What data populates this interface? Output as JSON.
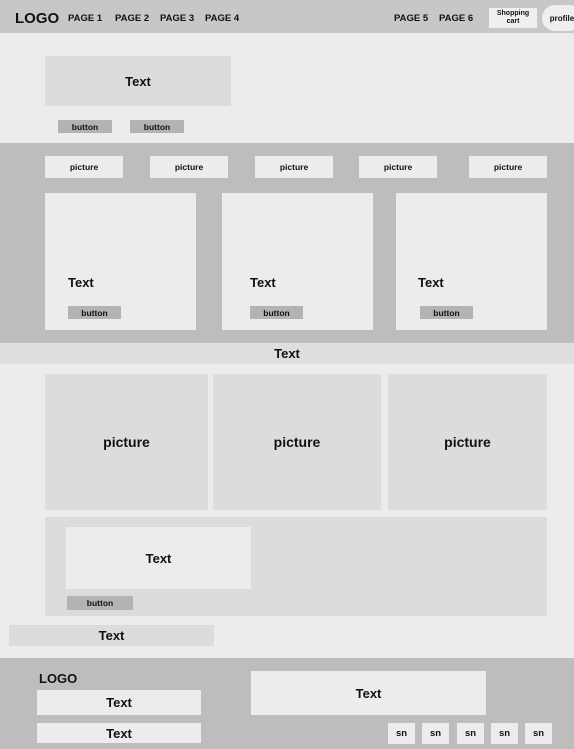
{
  "header": {
    "logo": "LOGO",
    "nav_left": [
      "PAGE 1",
      "PAGE 2",
      "PAGE 3",
      "PAGE 4"
    ],
    "nav_right": [
      "PAGE 5",
      "PAGE 6"
    ],
    "cart_line1": "Shopping",
    "cart_line2": "cart",
    "profile": "profile"
  },
  "hero": {
    "text": "Text",
    "buttons": [
      "button",
      "button"
    ]
  },
  "gallery": {
    "pictures": [
      "picture",
      "picture",
      "picture",
      "picture",
      "picture"
    ],
    "cards": [
      {
        "text": "Text",
        "button": "button"
      },
      {
        "text": "Text",
        "button": "button"
      },
      {
        "text": "Text",
        "button": "button"
      }
    ]
  },
  "banner": {
    "text": "Text"
  },
  "feature": {
    "pictures": [
      "picture",
      "picture",
      "picture"
    ],
    "text": "Text",
    "button": "button"
  },
  "strip": {
    "text": "Text"
  },
  "footer": {
    "logo": "LOGO",
    "text_left_1": "Text",
    "text_left_2": "Text",
    "text_center": "Text",
    "social": [
      "sn",
      "sn",
      "sn",
      "sn",
      "sn"
    ]
  }
}
